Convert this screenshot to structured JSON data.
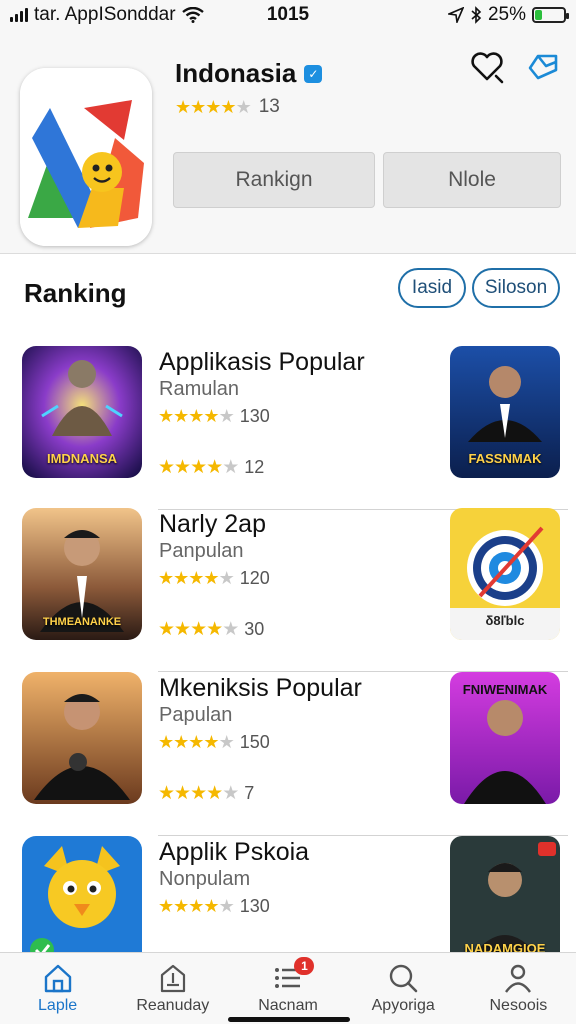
{
  "status_bar": {
    "carrier": "tar. AppISonddar",
    "time": "1015",
    "battery": "25%",
    "battery_level": 0.25
  },
  "app": {
    "name": "Indonasia",
    "rating_value": 4,
    "rating_count": "13",
    "buttons": {
      "primary": "Rankign",
      "secondary": "Nlole"
    }
  },
  "ranking": {
    "title": "Ranking",
    "filters": [
      "Iasid",
      "Siloson"
    ]
  },
  "list": [
    {
      "title": "Applikasis Popular",
      "subtitle": "Ramulan",
      "rating1_stars": 4,
      "rating1_count": "130",
      "rating2_stars": 4,
      "rating2_count": "12",
      "thumb_caption": "IMDNANSA",
      "thumb_right_caption": "FASSNMAK"
    },
    {
      "title": "Narly 2ap",
      "subtitle": "Panpulan",
      "rating1_stars": 4,
      "rating1_count": "120",
      "rating2_stars": 4,
      "rating2_count": "30",
      "thumb_caption": "THMEANANKE",
      "thumb_right_caption": "δ8ľblc"
    },
    {
      "title": "Mkeniksis Popular",
      "subtitle": "Papulan",
      "rating1_stars": 4,
      "rating1_count": "150",
      "rating2_stars": 4,
      "rating2_count": "7",
      "thumb_caption": "",
      "thumb_right_caption": "FNIWENIMAK"
    },
    {
      "title": "Applik Pskoia",
      "subtitle": "Nonpulam",
      "rating1_stars": 4,
      "rating1_count": "130",
      "rating2_stars": 0,
      "rating2_count": "",
      "thumb_caption": "",
      "thumb_right_caption": "NADAMGIOE"
    }
  ],
  "tabs": [
    {
      "label": "Laple",
      "icon": "home-icon",
      "active": true
    },
    {
      "label": "Reanuday",
      "icon": "update-icon",
      "active": false
    },
    {
      "label": "Nacnam",
      "icon": "list-icon",
      "active": false,
      "badge": "1"
    },
    {
      "label": "Apyoriga",
      "icon": "search-icon",
      "active": false
    },
    {
      "label": "Nesoois",
      "icon": "profile-icon",
      "active": false
    }
  ],
  "colors": {
    "accent": "#1b75c9",
    "star": "#f5b800",
    "pill_border": "#1f6fa8",
    "badge": "#e0312b"
  }
}
